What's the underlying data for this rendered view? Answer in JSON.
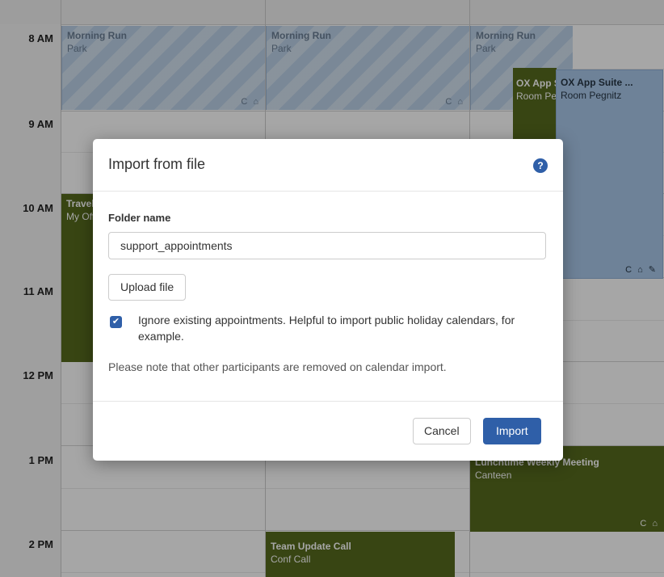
{
  "calendar": {
    "times": [
      "8 AM",
      "9 AM",
      "10 AM",
      "11 AM",
      "12 PM",
      "1 PM",
      "2 PM"
    ],
    "events": {
      "run1": {
        "title": "Morning Run",
        "location": "Park",
        "icons": "C ⌂"
      },
      "run2": {
        "title": "Morning Run",
        "location": "Park",
        "icons": "C ⌂"
      },
      "run3": {
        "title": "Morning Run",
        "location": "Park"
      },
      "ox1": {
        "title": "OX App Suite ...",
        "location": "Room Pegnitz"
      },
      "ox2": {
        "title": "OX App Suite ...",
        "location": "Room Pegnitz",
        "icons": "C ⌂ ✎"
      },
      "travel": {
        "title": "Travel",
        "location": "My Office"
      },
      "lunch": {
        "title": "Lunchtime Weekly Meeting",
        "location": "Canteen",
        "icons": "C ⌂"
      },
      "team": {
        "title": "Team Update Call",
        "location": "Conf Call"
      }
    }
  },
  "dialog": {
    "title": "Import from file",
    "help_icon": "?",
    "folder_label": "Folder name",
    "folder_value": "support_appointments",
    "upload_label": "Upload file",
    "ignore_checked": true,
    "ignore_text": "Ignore existing appointments. Helpful to import public holiday calendars, for example.",
    "note": "Please note that other participants are removed on calendar import.",
    "cancel_label": "Cancel",
    "import_label": "Import"
  },
  "colors": {
    "accent": "#2f5fa8",
    "event_green": "#566b1e",
    "event_blue": "#a9c8ea"
  }
}
